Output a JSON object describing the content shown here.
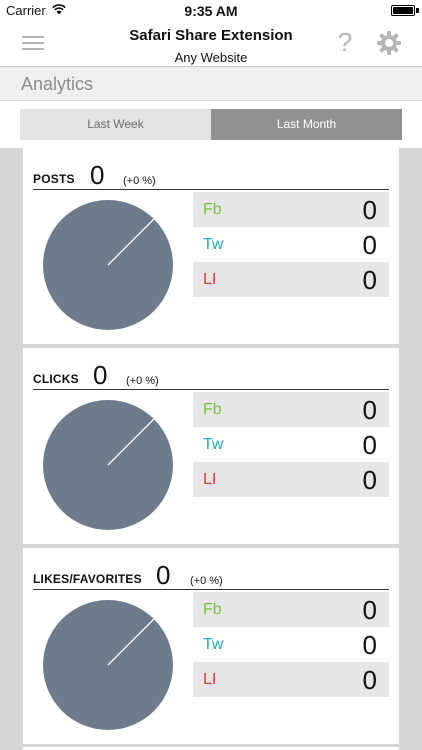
{
  "status_bar": {
    "carrier": "Carrier",
    "time": "9:35 AM"
  },
  "nav": {
    "title": "Safari Share Extension",
    "subtitle": "Any Website",
    "help_label": "?",
    "menu_icon": "hamburger-menu-icon",
    "settings_icon": "gear-icon"
  },
  "section": {
    "title": "Analytics"
  },
  "range": {
    "options": [
      "Last Week",
      "Last Month"
    ],
    "selected": "Last Month"
  },
  "colors": {
    "facebook": "#7dc142",
    "twitter": "#26a6b8",
    "linkedin": "#e53935",
    "pie": "#6e7b8b",
    "selected_segment": "#919191"
  },
  "cards": [
    {
      "label": "POSTS",
      "count": "0",
      "change": "(+0 %)",
      "networks": [
        {
          "label": "Fb",
          "value": "0"
        },
        {
          "label": "Tw",
          "value": "0"
        },
        {
          "label": "LI",
          "value": "0"
        }
      ]
    },
    {
      "label": "CLICKS",
      "count": "0",
      "change": "(+0 %)",
      "networks": [
        {
          "label": "Fb",
          "value": "0"
        },
        {
          "label": "Tw",
          "value": "0"
        },
        {
          "label": "LI",
          "value": "0"
        }
      ]
    },
    {
      "label": "LIKES/FAVORITES",
      "count": "0",
      "change": "(+0 %)",
      "networks": [
        {
          "label": "Fb",
          "value": "0"
        },
        {
          "label": "Tw",
          "value": "0"
        },
        {
          "label": "LI",
          "value": "0"
        }
      ]
    }
  ]
}
